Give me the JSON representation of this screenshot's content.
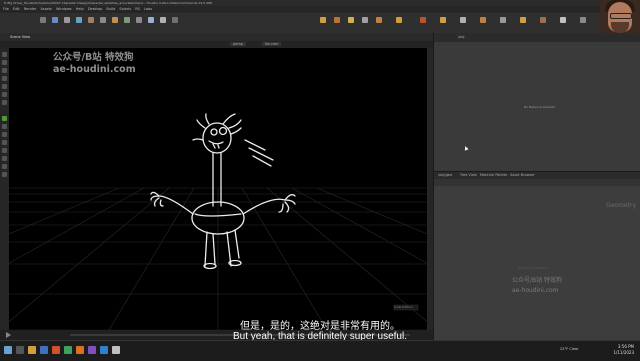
{
  "window": {
    "title": "E:/My Drive/_HoudiniSchool/CLASS/07 Character Design/character_sketches_accurated.hipnc - Houdini Indie Limited-Commercial 19.5.398"
  },
  "menubar": {
    "items": [
      "File",
      "Edit",
      "Render",
      "Assets",
      "Windows",
      "Help",
      "Desktop",
      "Build",
      "Solaris",
      "RS",
      "Labs"
    ]
  },
  "viewport": {
    "tab_label": "Scene View",
    "toolbar_left": "persp",
    "toolbar_mid": "No cam",
    "indie_label": "Indie Edition"
  },
  "watermark": {
    "line1": "公众号/B站 特效狗",
    "line2": "ae-houdini.com"
  },
  "watermark_right": {
    "line1": "公众号/B站 特效狗",
    "line2": "ae-houdini.com"
  },
  "subtitle": {
    "chinese": "但是，是的，这绝对是非常有用的。",
    "english": "But yeah, that is definitely super useful."
  },
  "right_top": {
    "path": "/obj",
    "message": "No Network selected"
  },
  "right_bottom": {
    "tabs": [
      "/obj/geo",
      "Tree View",
      "Material Palette",
      "Asset Browser"
    ],
    "geometry_label": "Geometry",
    "faint_label": "Solaris Networks"
  },
  "taskbar": {
    "temp": "22°F",
    "weather": "Clear",
    "time": "3:56 PM",
    "date": "1/11/2023"
  },
  "colors": {
    "accent_green": "#4d9c3a",
    "accent_orange": "#d17a1f",
    "drawing": "#ececec"
  }
}
